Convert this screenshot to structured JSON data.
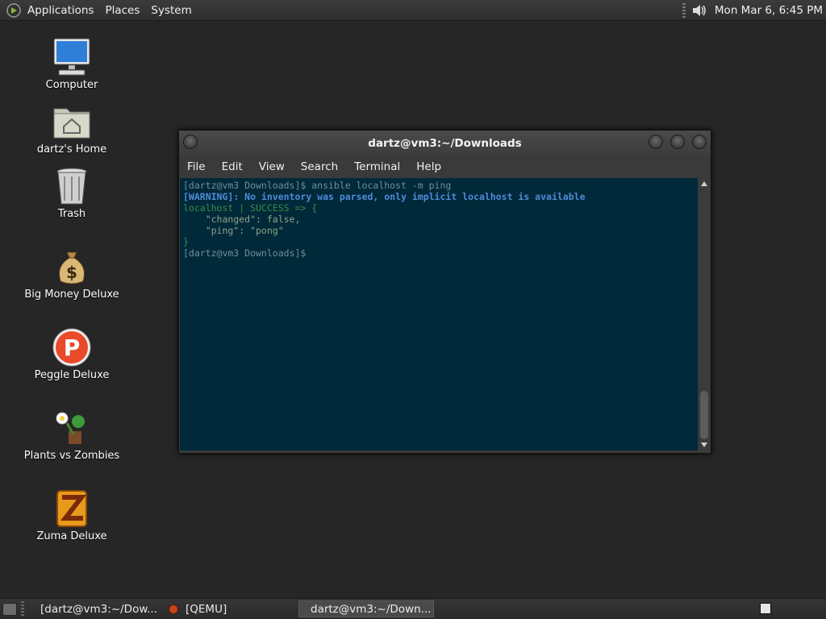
{
  "top_panel": {
    "menus": [
      "Applications",
      "Places",
      "System"
    ],
    "clock": "Mon Mar  6,  6:45 PM"
  },
  "desktop_icons": [
    {
      "label": "Computer",
      "icon": "computer-icon"
    },
    {
      "label": "dartz's Home",
      "icon": "home-folder-icon"
    },
    {
      "label": "Trash",
      "icon": "trash-icon"
    },
    {
      "label": "Big Money Deluxe",
      "icon": "money-bag-icon"
    },
    {
      "label": "Peggle Deluxe",
      "icon": "peggle-icon"
    },
    {
      "label": "Plants vs Zombies",
      "icon": "plants-icon"
    },
    {
      "label": "Zuma Deluxe",
      "icon": "zuma-icon"
    }
  ],
  "terminal": {
    "title": "dartz@vm3:~/Downloads",
    "menu": [
      "File",
      "Edit",
      "View",
      "Search",
      "Terminal",
      "Help"
    ],
    "lines": {
      "l1": "[dartz@vm3 Downloads]$ ansible localhost -m ping",
      "l2a": "[WARNING]",
      "l2b": ": No inventory was parsed, only implicit localhost is available",
      "l3": "localhost | SUCCESS => {",
      "l4": "    \"changed\": false,",
      "l5": "    \"ping\": \"pong\"",
      "l6": "}",
      "l7": "[dartz@vm3 Downloads]$ "
    },
    "colors": {
      "background": "#00293a",
      "warning": "#4f8bd8",
      "success": "#3d8c4a"
    }
  },
  "taskbar": {
    "tasks": [
      "[dartz@vm3:~/Dow...",
      "[QEMU]",
      "dartz@vm3:~/Down..."
    ]
  }
}
